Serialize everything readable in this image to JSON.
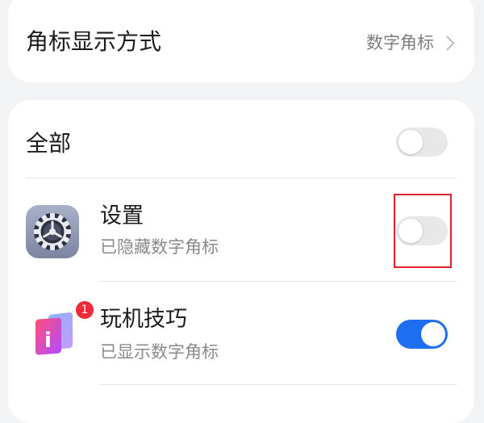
{
  "badge_style_row": {
    "label": "角标显示方式",
    "value": "数字角标",
    "chevron_icon": "chevron-right-icon"
  },
  "list": {
    "all": {
      "label": "全部",
      "enabled": false
    },
    "apps": [
      {
        "name": "设置",
        "status": "已隐藏数字角标",
        "icon": "settings-gear-icon",
        "enabled": false
      },
      {
        "name": "玩机技巧",
        "status": "已显示数字角标",
        "icon": "tips-app-icon",
        "badge_count": "1",
        "enabled": true
      }
    ]
  },
  "colors": {
    "toggle_on": "#1e6ef0",
    "toggle_off": "#e8e8e8",
    "highlight": "#e0202a",
    "badge": "#f2293a"
  }
}
